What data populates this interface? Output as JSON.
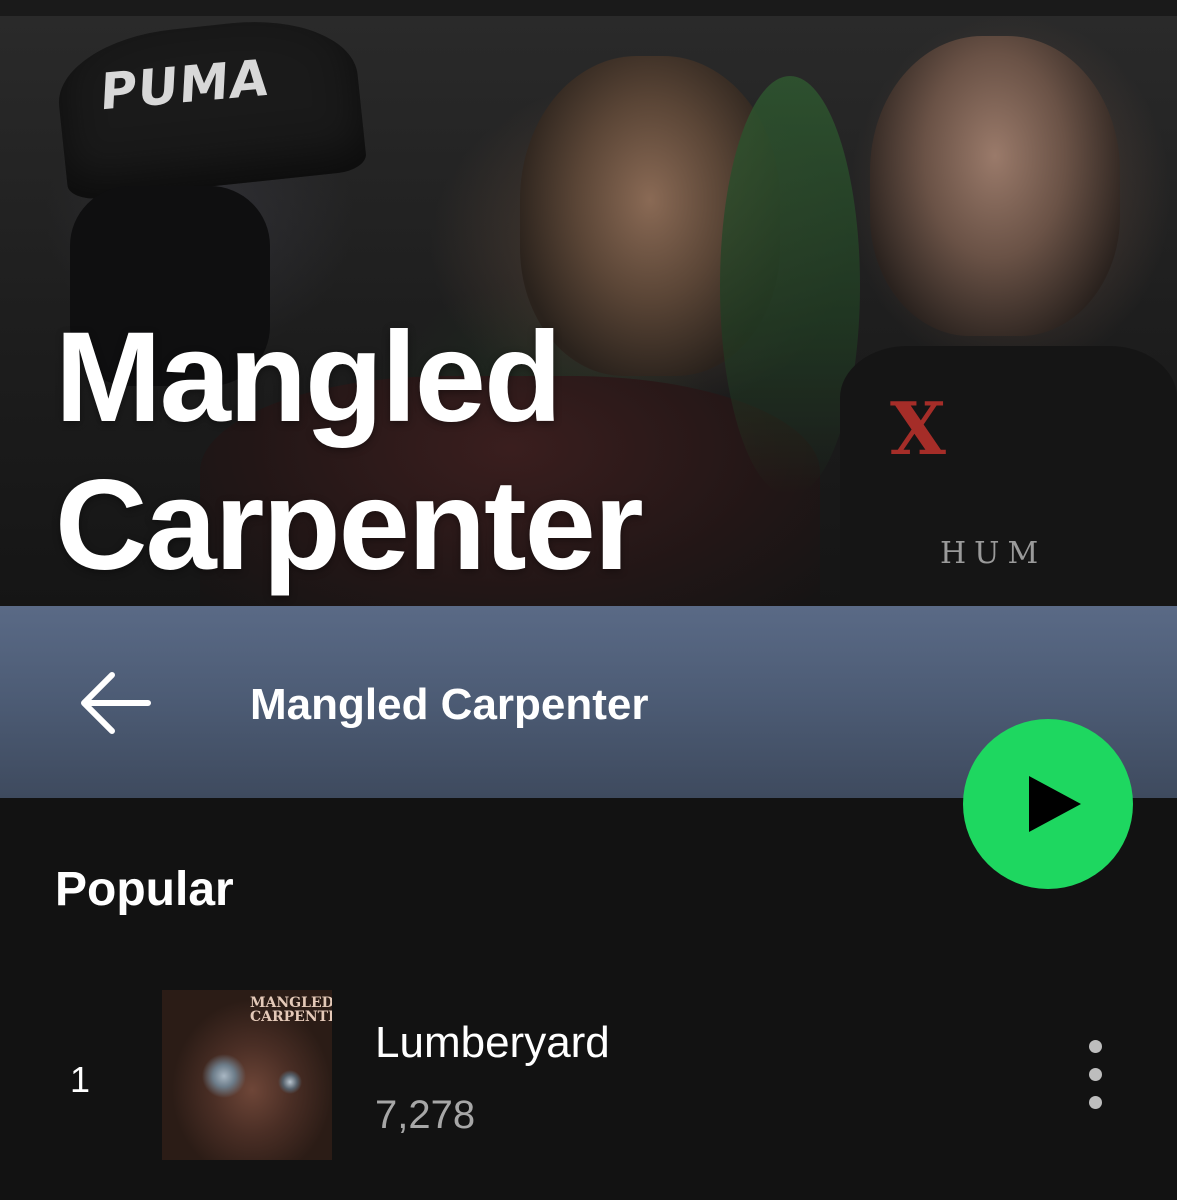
{
  "artist": {
    "name": "Mangled Carpenter",
    "hero_title_line1": "Mangled",
    "hero_title_line2": "Carpenter",
    "hero_cap_logo": "PUMA",
    "hero_shirt_text": "HUM"
  },
  "header": {
    "title": "Mangled Carpenter",
    "back_icon": "arrow-left-icon"
  },
  "play_button": {
    "icon": "play-icon",
    "color": "#1ed760"
  },
  "popular": {
    "heading": "Popular",
    "tracks": [
      {
        "index": "1",
        "title": "Lumberyard",
        "plays": "7,278",
        "art_text": "MANGLED CARPENTER"
      }
    ]
  },
  "colors": {
    "background": "#121212",
    "header_gradient_top": "#5a6a86",
    "header_gradient_bottom": "#3e4a5e",
    "secondary_text": "#a7a7a7",
    "accent": "#1ed760"
  }
}
